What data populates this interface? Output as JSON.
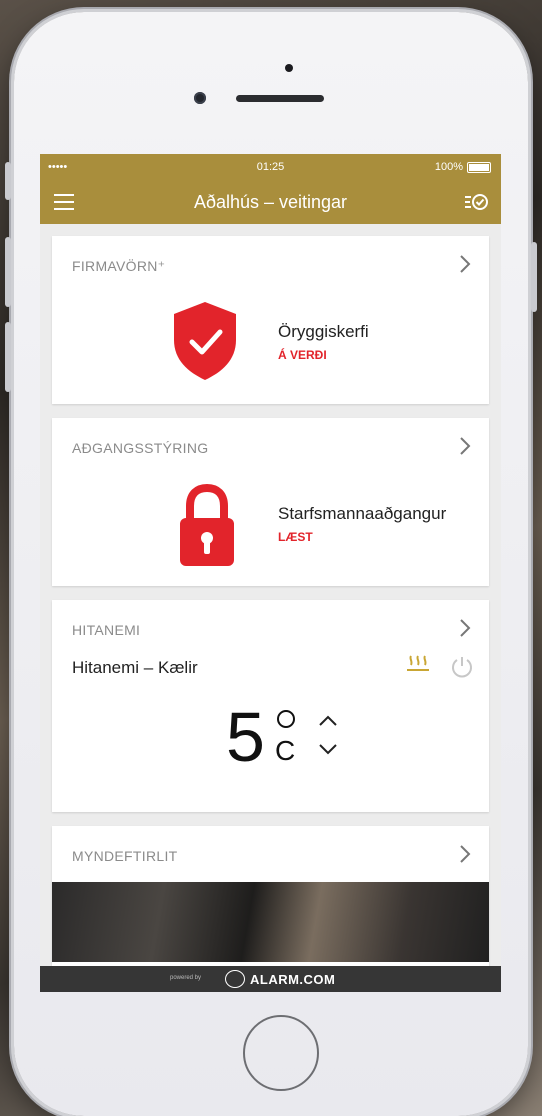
{
  "status_bar": {
    "signal": "••••• ",
    "time": "01:25",
    "battery": "100%"
  },
  "nav": {
    "title": "Aðalhús – veitingar"
  },
  "cards": {
    "security": {
      "title": "FIRMAVÖRN⁺",
      "item_label": "Öryggiskerfi",
      "item_status": "Á VERÐI"
    },
    "access": {
      "title": "AÐGANGSSTÝRING",
      "item_label": "Starfsmannaaðgangur",
      "item_status": "LÆST"
    },
    "thermostat": {
      "title": "HITANEMI",
      "device_name": "Hitanemi – Kælir",
      "temperature": "5",
      "unit": "C"
    },
    "video": {
      "title": "MYNDEFTIRLIT"
    }
  },
  "footer": {
    "powered_by": "powered by",
    "brand": "ALARM.COM"
  },
  "colors": {
    "accent": "#a98e3c",
    "alert": "#e2242b",
    "heat": "#c9a634"
  }
}
